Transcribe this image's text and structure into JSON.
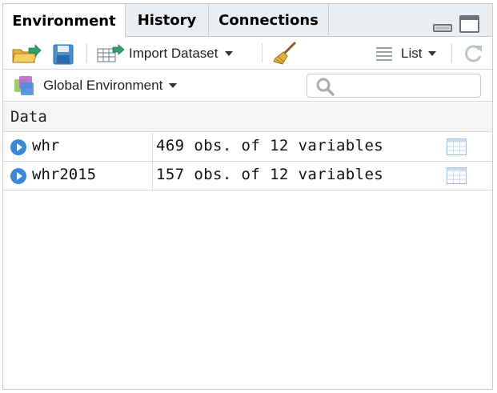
{
  "tabs": [
    {
      "label": "Environment",
      "active": true
    },
    {
      "label": "History",
      "active": false
    },
    {
      "label": "Connections",
      "active": false
    }
  ],
  "toolbar": {
    "import_dataset_label": "Import Dataset",
    "view_mode_label": "List"
  },
  "environment": {
    "selected": "Global Environment",
    "search_placeholder": ""
  },
  "data_section": {
    "header": "Data",
    "rows": [
      {
        "name": "whr",
        "value": "469 obs. of 12 variables"
      },
      {
        "name": "whr2015",
        "value": "157 obs. of 12 variables"
      }
    ]
  },
  "colors": {
    "tabbar_bg": "#eaeef1",
    "accent_blue": "#3b89d6",
    "border": "#c8ccd1"
  },
  "icons": [
    "open-folder-icon",
    "save-icon",
    "import-dataset-icon",
    "broom-icon",
    "list-icon",
    "refresh-icon",
    "environment-icon",
    "search-icon",
    "play-icon",
    "grid-view-icon",
    "minimize-icon",
    "maximize-icon"
  ]
}
